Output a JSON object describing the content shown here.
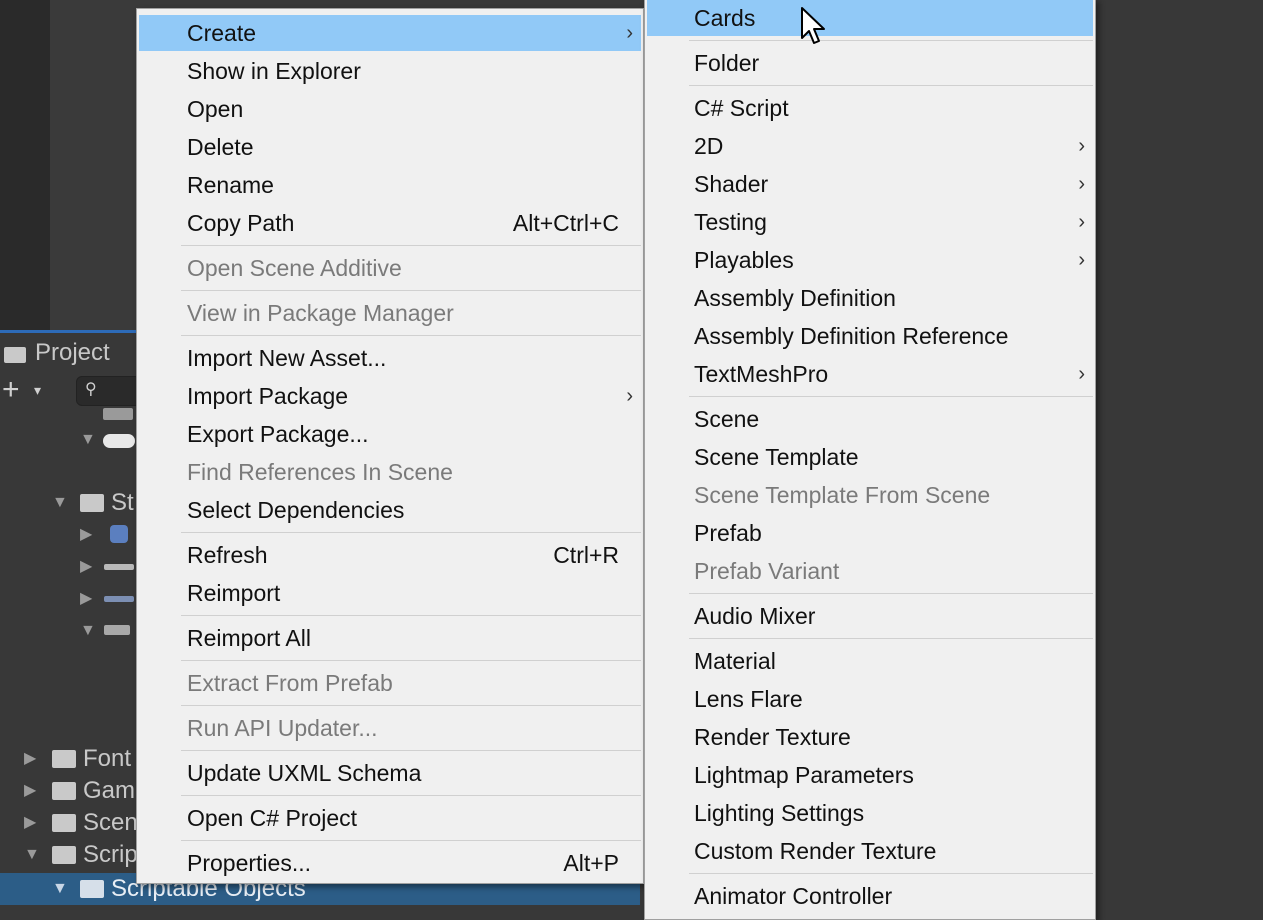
{
  "project_panel": {
    "tab_label": "Project",
    "add_button": "+",
    "tree": [
      {
        "label": "St"
      },
      {
        "label": "Font"
      },
      {
        "label": "Gam"
      },
      {
        "label": "Scen"
      },
      {
        "label": "Scrip"
      },
      {
        "label": "Scriptable Objects"
      }
    ]
  },
  "context_menu": {
    "items": [
      {
        "label": "Create",
        "has_submenu": true,
        "highlighted": true
      },
      {
        "label": "Show in Explorer"
      },
      {
        "label": "Open"
      },
      {
        "label": "Delete"
      },
      {
        "label": "Rename"
      },
      {
        "label": "Copy Path",
        "shortcut": "Alt+Ctrl+C"
      },
      {
        "label": "Open Scene Additive",
        "disabled": true
      },
      {
        "label": "View in Package Manager",
        "disabled": true
      },
      {
        "label": "Import New Asset..."
      },
      {
        "label": "Import Package",
        "has_submenu": true
      },
      {
        "label": "Export Package..."
      },
      {
        "label": "Find References In Scene",
        "disabled": true
      },
      {
        "label": "Select Dependencies"
      },
      {
        "label": "Refresh",
        "shortcut": "Ctrl+R"
      },
      {
        "label": "Reimport"
      },
      {
        "label": "Reimport All"
      },
      {
        "label": "Extract From Prefab",
        "disabled": true
      },
      {
        "label": "Run API Updater...",
        "disabled": true
      },
      {
        "label": "Update UXML Schema"
      },
      {
        "label": "Open C# Project"
      },
      {
        "label": "Properties...",
        "shortcut": "Alt+P"
      }
    ]
  },
  "create_submenu": {
    "items": [
      {
        "label": "Cards",
        "highlighted": true
      },
      {
        "label": "Folder"
      },
      {
        "label": "C# Script"
      },
      {
        "label": "2D",
        "has_submenu": true
      },
      {
        "label": "Shader",
        "has_submenu": true
      },
      {
        "label": "Testing",
        "has_submenu": true
      },
      {
        "label": "Playables",
        "has_submenu": true
      },
      {
        "label": "Assembly Definition"
      },
      {
        "label": "Assembly Definition Reference"
      },
      {
        "label": "TextMeshPro",
        "has_submenu": true
      },
      {
        "label": "Scene"
      },
      {
        "label": "Scene Template"
      },
      {
        "label": "Scene Template From Scene",
        "disabled": true
      },
      {
        "label": "Prefab"
      },
      {
        "label": "Prefab Variant",
        "disabled": true
      },
      {
        "label": "Audio Mixer"
      },
      {
        "label": "Material"
      },
      {
        "label": "Lens Flare"
      },
      {
        "label": "Render Texture"
      },
      {
        "label": "Lightmap Parameters"
      },
      {
        "label": "Lighting Settings"
      },
      {
        "label": "Custom Render Texture"
      },
      {
        "label": "Animator Controller"
      }
    ]
  },
  "icons": {
    "submenu_arrow": "›",
    "collapse_arrow": "▼",
    "expand_arrow": "▶",
    "search": "⚲",
    "dropdown": "▾"
  },
  "colors": {
    "highlight": "#91c9f7",
    "selection": "#2c5d87",
    "menu_bg": "#f0f0f0",
    "disabled_text": "#7a7a7a"
  }
}
